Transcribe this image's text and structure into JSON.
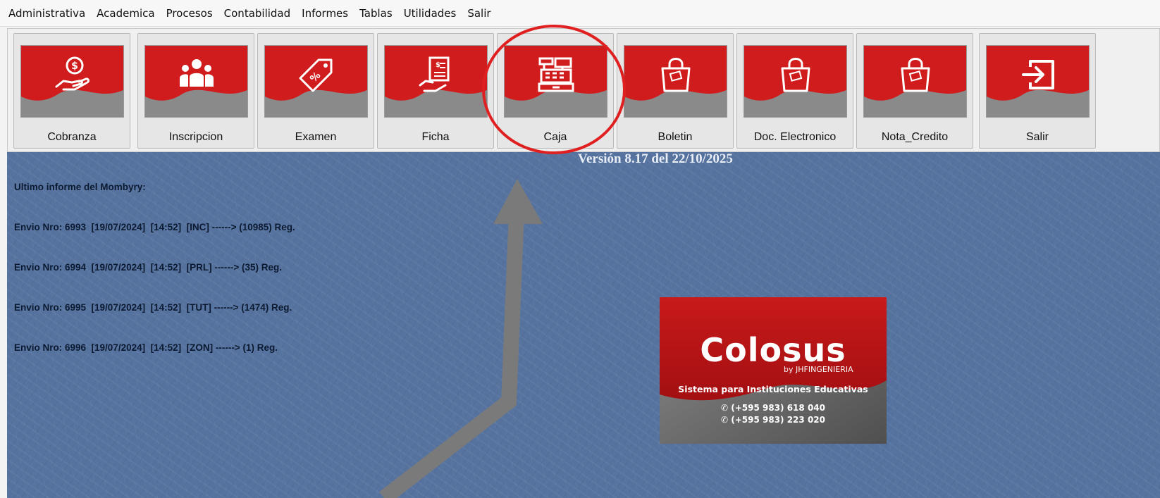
{
  "menu": [
    "Administrativa",
    "Academica",
    "Procesos",
    "Contabilidad",
    "Informes",
    "Tablas",
    "Utilidades",
    "Salir"
  ],
  "toolbar": {
    "buttons": [
      {
        "label": "Cobranza",
        "icon": "money-hand-icon"
      },
      {
        "label": "Inscripcion",
        "icon": "people-group-icon"
      },
      {
        "label": "Examen",
        "icon": "percent-tag-icon"
      },
      {
        "label": "Ficha",
        "icon": "document-hand-icon"
      },
      {
        "label": "Caja",
        "icon": "cash-register-icon"
      },
      {
        "label": "Boletin",
        "icon": "shopping-bag-icon"
      },
      {
        "label": "Doc. Electronico",
        "icon": "shopping-bag-icon"
      },
      {
        "label": "Nota_Credito",
        "icon": "shopping-bag-icon"
      },
      {
        "label": "Salir",
        "icon": "exit-icon"
      }
    ],
    "tile_colors": {
      "red": "#d01c1c",
      "gray": "#8a8a8a"
    }
  },
  "report": {
    "heading": "Ultimo informe del Mombyry:",
    "lines": [
      "Envio Nro: 6993  [19/07/2024]  [14:52]  [INC] ------> (10985) Reg.",
      "Envio Nro: 6994  [19/07/2024]  [14:52]  [PRL] ------> (35) Reg.",
      "Envio Nro: 6995  [19/07/2024]  [14:52]  [TUT] ------> (1474) Reg.",
      "Envio Nro: 6996  [19/07/2024]  [14:52]  [ZON] ------> (1) Reg."
    ]
  },
  "version": "Versión 8.17 del 22/10/2025",
  "logo": {
    "title": "Colosus",
    "by": "by JHFINGENIERIA",
    "subtitle": "Sistema para Instituciones Educativas",
    "phones": [
      "(+595 983) 618 040",
      "(+595 983) 223 020"
    ]
  },
  "annotations": {
    "highlight_color": "#e02020",
    "arrow_color": "#7a7a7a"
  },
  "colors": {
    "background": "#56739f",
    "menubar": "#f7f7f7"
  }
}
